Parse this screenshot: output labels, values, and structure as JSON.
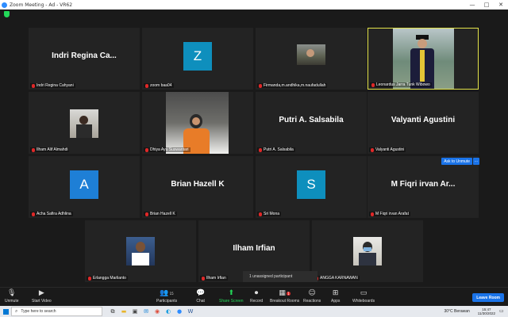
{
  "window": {
    "title": "Zoom Meeting - Ad - VR62",
    "controls": [
      "—",
      "□",
      "✕"
    ]
  },
  "tiles": [
    {
      "id": "indri",
      "display_name": "Indri Regina Ca...",
      "label": "Indri Regina Cahyani",
      "type": "name"
    },
    {
      "id": "zoom",
      "display_name": "Z",
      "label": "zoom baa04",
      "type": "avatar"
    },
    {
      "id": "firmanda",
      "display_name": "",
      "label": "Firmanda,m.andhika,m.naufadullah",
      "type": "photo"
    },
    {
      "id": "leonardus",
      "display_name": "",
      "label": "Leonardus Jarra Tunk Wibowo",
      "type": "photo",
      "active": true
    },
    {
      "id": "ilham_alif",
      "display_name": "",
      "label": "Ilham Alif Almahdi",
      "type": "photo"
    },
    {
      "id": "dhiya",
      "display_name": "",
      "label": "Dhiya Ayu Suswantari",
      "type": "photo"
    },
    {
      "id": "putri",
      "display_name": "Putri A. Salsabila",
      "label": "Putri A. Salsabila",
      "type": "name"
    },
    {
      "id": "valyanti",
      "display_name": "Valyanti Agustini",
      "label": "Valyanti Agustini",
      "type": "name"
    },
    {
      "id": "acha",
      "display_name": "A",
      "label": "Acha Safira Adhlina",
      "type": "avatar"
    },
    {
      "id": "brian",
      "display_name": "Brian Hazell K",
      "label": "Brian Hazell K",
      "type": "name"
    },
    {
      "id": "sri",
      "display_name": "S",
      "label": "Sri Mona",
      "type": "avatar"
    },
    {
      "id": "fiqri",
      "display_name": "M Fiqri irvan Ar...",
      "label": "M Fiqri irvan Arafat",
      "type": "name"
    },
    {
      "id": "erlangga",
      "display_name": "",
      "label": "Erlangga Marlianto",
      "type": "photo"
    },
    {
      "id": "ilham_irfian",
      "display_name": "Ilham Irfian",
      "label": "Ilham Irfian",
      "type": "name"
    },
    {
      "id": "angga",
      "display_name": "",
      "label": "ANGGA KARNAWAN",
      "type": "photo"
    }
  ],
  "ask_to_unmute": "Ask to Unmute",
  "more_glyph": "···",
  "unassigned": "1 unassigned participant",
  "toolbar": {
    "unmute": "Unmute",
    "start_video": "Start Video",
    "participants": "Participants",
    "participants_count": "15",
    "chat": "Chat",
    "share_screen": "Share Screen",
    "record": "Record",
    "breakout_rooms": "Breakout Rooms",
    "breakout_badge": "1",
    "reactions": "Reactions",
    "apps": "Apps",
    "whiteboards": "Whiteboards",
    "leave": "Leave Room"
  },
  "taskbar": {
    "search_placeholder": "Type here to search",
    "weather": "30°C  Berawan",
    "time": "15:47",
    "date": "11/30/2022"
  },
  "colors": {
    "accent": "#1a73e8",
    "active_border": "#e3e34a",
    "avatar": "#0e8fbd",
    "muted": "#e02828",
    "share": "#23d959"
  }
}
